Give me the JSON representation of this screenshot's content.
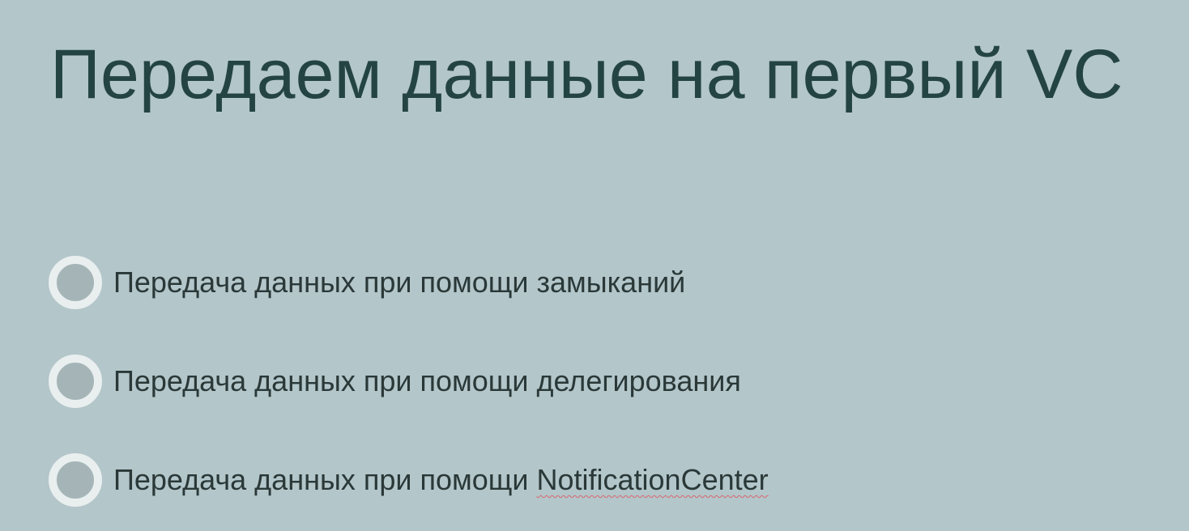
{
  "slide": {
    "title": "Передаем данные на первый VC",
    "bullets": [
      {
        "text": "Передача данных при помощи замыканий"
      },
      {
        "text": "Передача данных при помощи делегирования"
      },
      {
        "text_prefix": "Передача данных при помощи ",
        "text_highlight": "NotificationCenter"
      }
    ]
  }
}
